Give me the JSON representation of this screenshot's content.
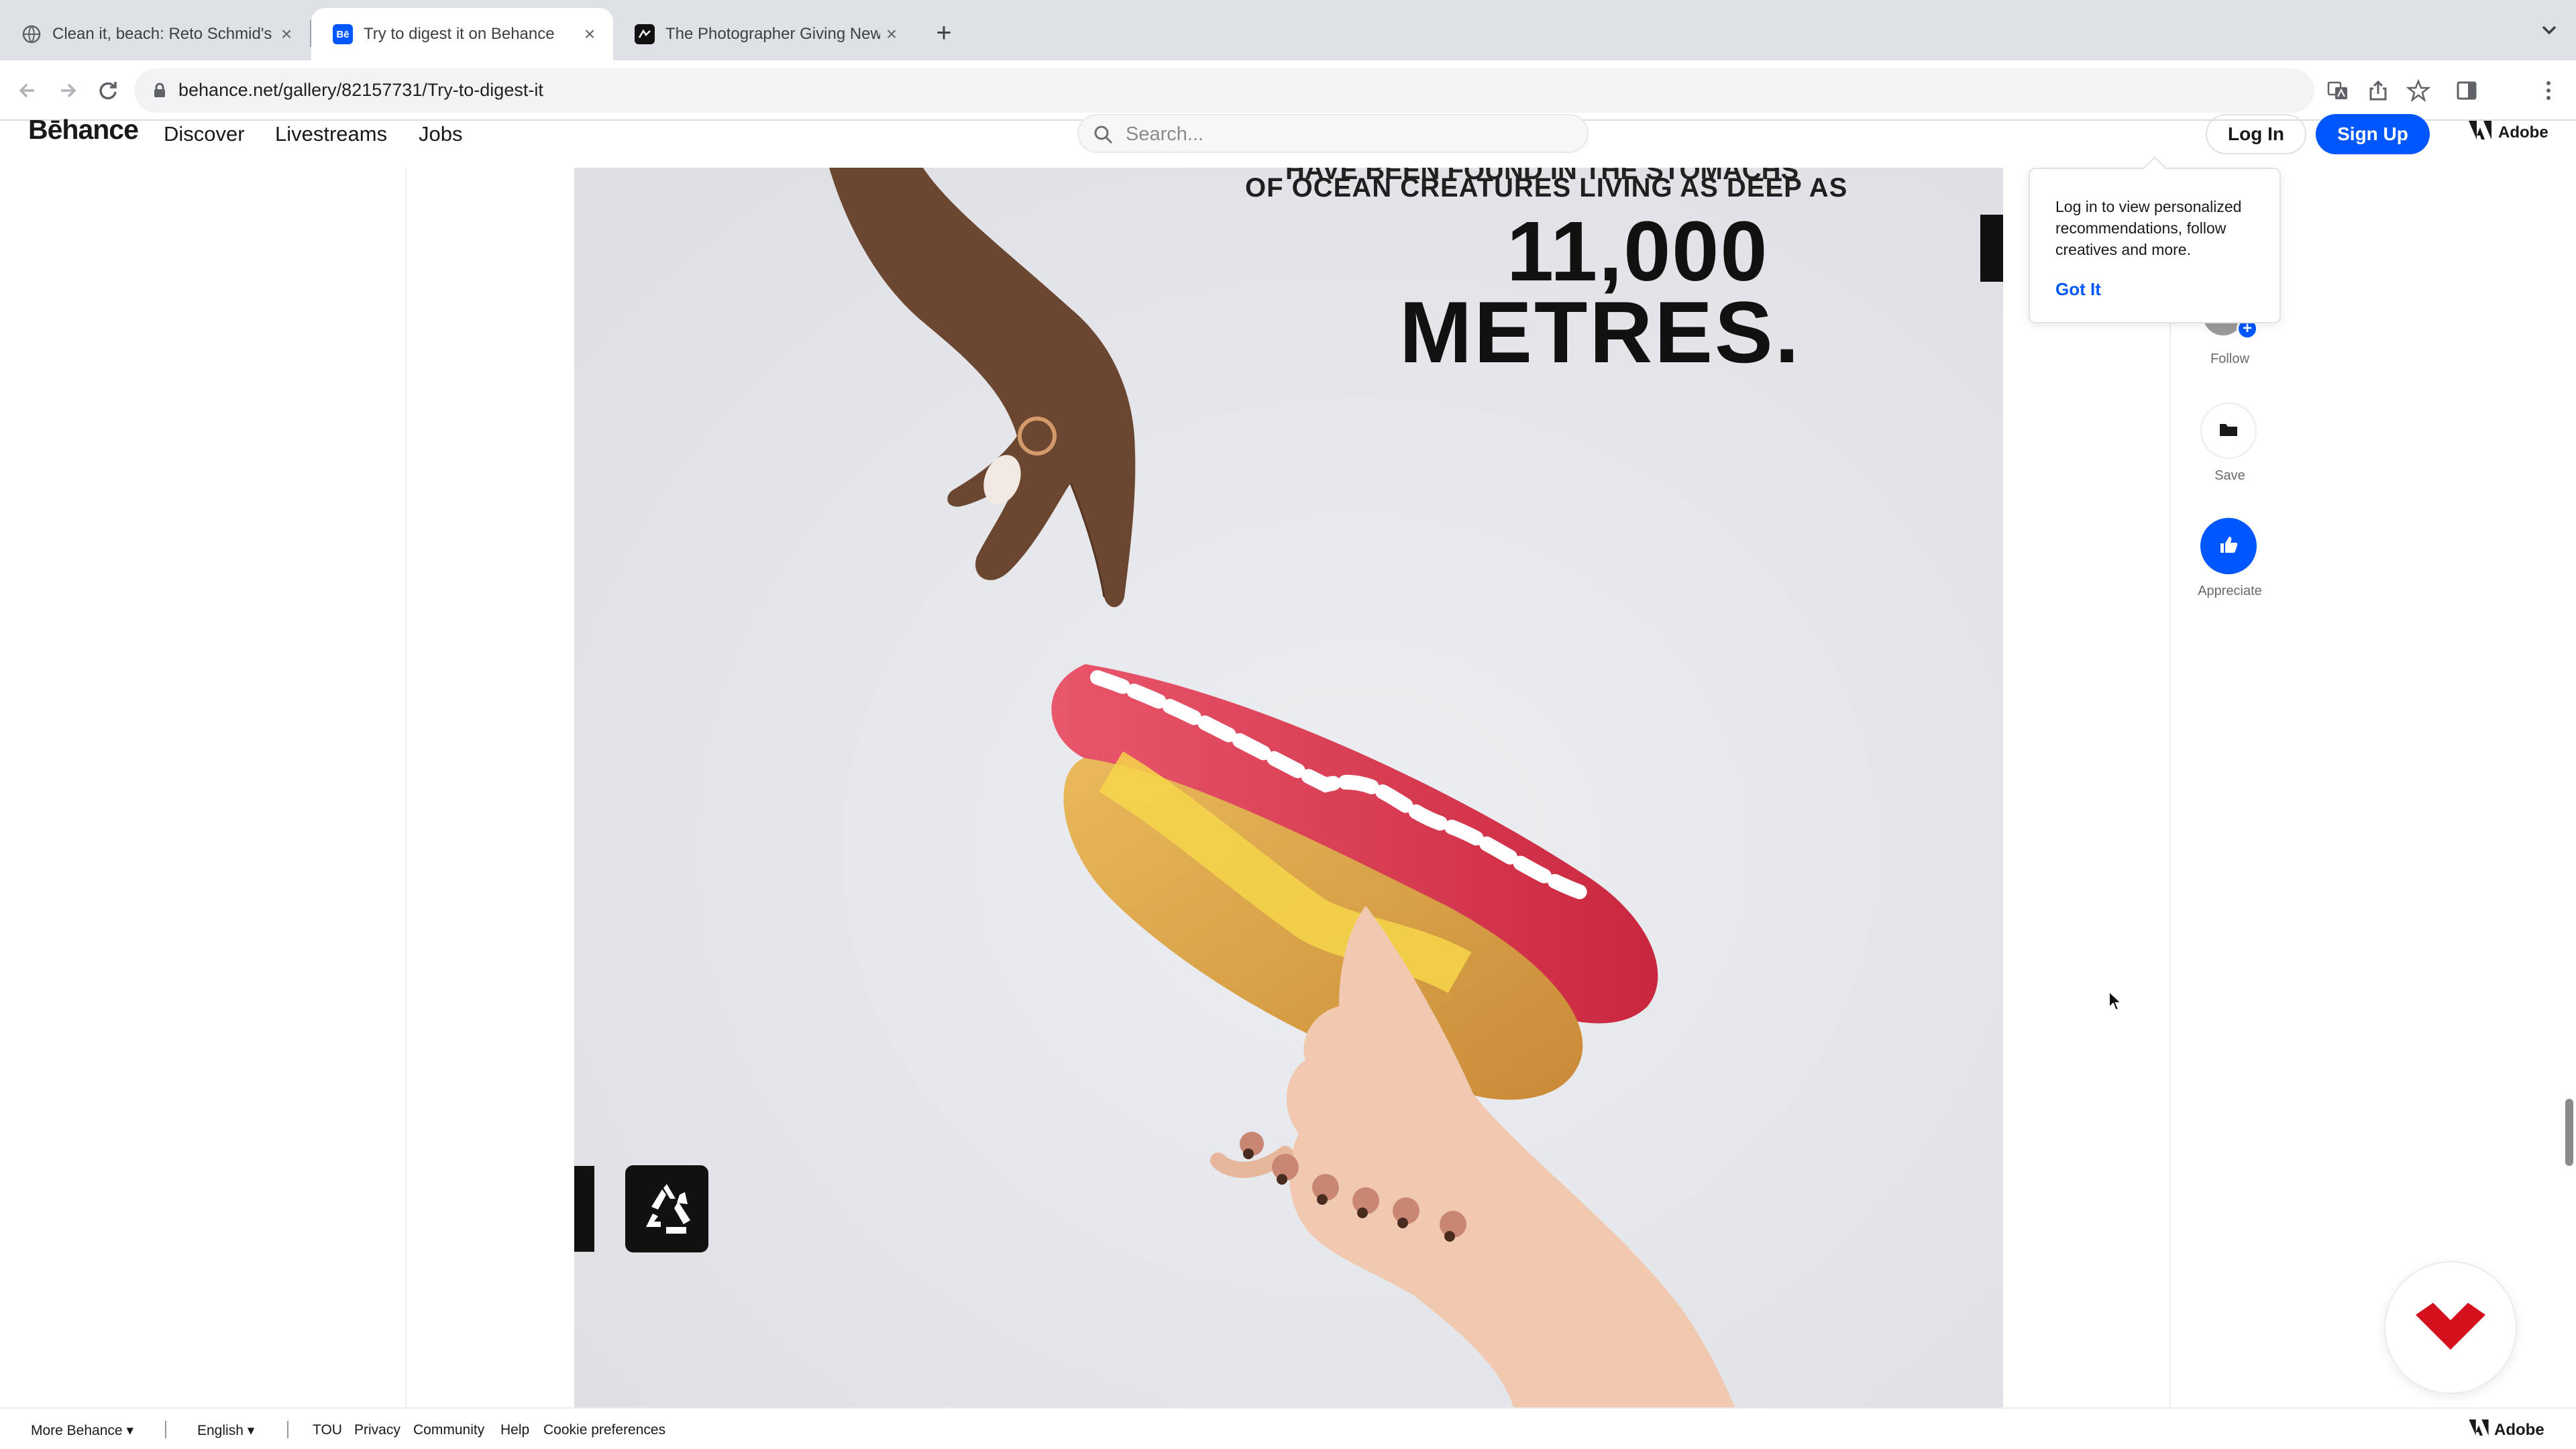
{
  "browser": {
    "tabs": [
      {
        "title": "Clean it, beach: Reto Schmid's",
        "active": false,
        "favicon": "globe-favicon"
      },
      {
        "title": "Try to digest it on Behance",
        "active": true,
        "favicon": "behance-favicon"
      },
      {
        "title": "The Photographer Giving New",
        "active": false,
        "favicon": "dark-favicon"
      }
    ],
    "behance_favicon_text": "Bē",
    "url": "behance.net/gallery/82157731/Try-to-digest-it"
  },
  "header": {
    "logo": "Bēhance",
    "nav": [
      "Discover",
      "Livestreams",
      "Jobs"
    ],
    "search_placeholder": "Search...",
    "login_label": "Log In",
    "signup_label": "Sign Up",
    "adobe_label": "Adobe"
  },
  "artwork": {
    "partial_line": "HAVE BEEN FOUND IN THE STOMACHS",
    "line1": "OF OCEAN CREATURES LIVING AS DEEP AS",
    "number": "11,000",
    "unit": "METRES.",
    "background_color": "#e3e4e8"
  },
  "rail": {
    "follow_label": "Follow",
    "save_label": "Save",
    "appreciate_label": "Appreciate"
  },
  "popover": {
    "text": "Log in to view personalized recommendations, follow creatives and more.",
    "got_it": "Got It"
  },
  "footer": {
    "more_behance": "More Behance",
    "language": "English",
    "links": [
      "TOU",
      "Privacy",
      "Community",
      "Help",
      "Cookie preferences"
    ],
    "adobe_label": "Adobe"
  },
  "colors": {
    "accent": "#0057ff",
    "widget_red": "#d4101c"
  }
}
